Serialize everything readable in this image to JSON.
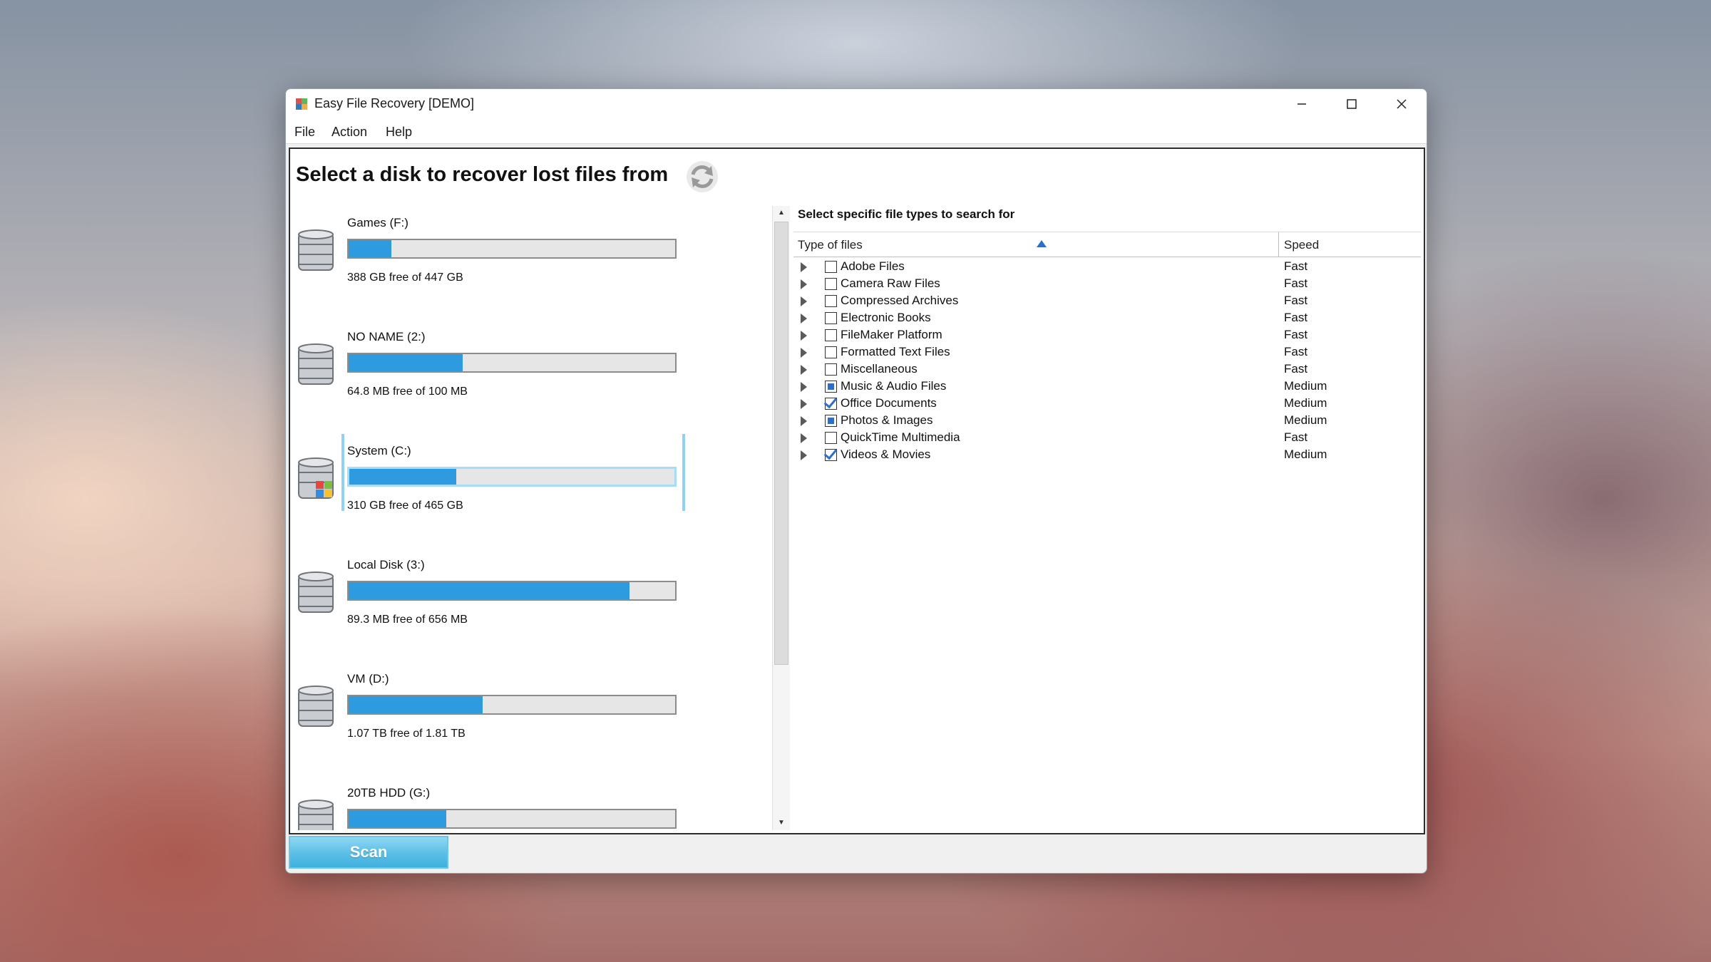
{
  "window": {
    "title": "Easy File Recovery [DEMO]"
  },
  "menu": [
    "File",
    "Action",
    "Help"
  ],
  "heading": "Select a disk to recover lost files from",
  "disks": [
    {
      "name": "Games (F:)",
      "free": "388 GB free of 447 GB",
      "used_fraction": 0.13,
      "icon": "hard-drive-icon"
    },
    {
      "name": "NO NAME (2:)",
      "free": "64.8 MB free of 100 MB",
      "used_fraction": 0.35,
      "icon": "hard-drive-icon"
    },
    {
      "name": "System (C:)",
      "free": "310 GB free of 465 GB",
      "used_fraction": 0.33,
      "icon": "system-drive-icon",
      "selected": true
    },
    {
      "name": "Local Disk (3:)",
      "free": "89.3 MB free of 656 MB",
      "used_fraction": 0.86,
      "icon": "hard-drive-icon"
    },
    {
      "name": "VM (D:)",
      "free": "1.07 TB free of 1.81 TB",
      "used_fraction": 0.41,
      "icon": "hard-drive-icon"
    },
    {
      "name": "20TB HDD (G:)",
      "free": "",
      "used_fraction": 0.3,
      "icon": "hard-drive-icon"
    }
  ],
  "file_types": {
    "title": "Select specific file types to search for",
    "columns": {
      "type": "Type of files",
      "speed": "Speed"
    },
    "rows": [
      {
        "label": "Adobe Files",
        "speed": "Fast",
        "state": "unchecked"
      },
      {
        "label": "Camera Raw Files",
        "speed": "Fast",
        "state": "unchecked"
      },
      {
        "label": "Compressed Archives",
        "speed": "Fast",
        "state": "unchecked"
      },
      {
        "label": "Electronic Books",
        "speed": "Fast",
        "state": "unchecked"
      },
      {
        "label": "FileMaker Platform",
        "speed": "Fast",
        "state": "unchecked"
      },
      {
        "label": "Formatted Text Files",
        "speed": "Fast",
        "state": "unchecked"
      },
      {
        "label": "Miscellaneous",
        "speed": "Fast",
        "state": "unchecked"
      },
      {
        "label": "Music & Audio Files",
        "speed": "Medium",
        "state": "partial"
      },
      {
        "label": "Office Documents",
        "speed": "Medium",
        "state": "checked"
      },
      {
        "label": "Photos & Images",
        "speed": "Medium",
        "state": "partial"
      },
      {
        "label": "QuickTime Multimedia",
        "speed": "Fast",
        "state": "unchecked"
      },
      {
        "label": "Videos & Movies",
        "speed": "Medium",
        "state": "checked"
      }
    ]
  },
  "scan_button": "Scan",
  "colors": {
    "bar_fill": "#2e9be0",
    "selection": "#8fd2f2",
    "scan": "#5ec0e6"
  }
}
